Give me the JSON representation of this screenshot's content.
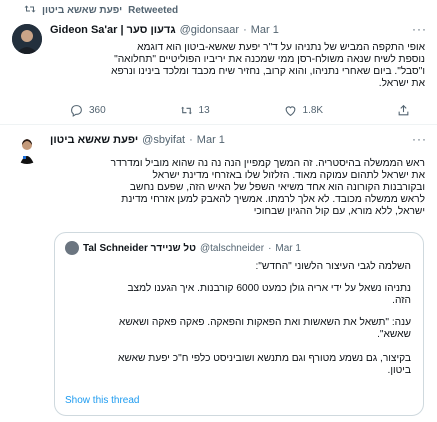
{
  "retweet_header": {
    "user": "יפעת שאשא ביטון",
    "label": "Retweeted"
  },
  "tweet1": {
    "display_name": "Gideon Sa'ar | גדעון סער",
    "handle": "@gidonsaar",
    "sep": "·",
    "date": "Mar 1",
    "lines": [
      "אופי התקפה המביש של נתניהו על ד\"ר יפעת שאשא-ביטון הוא דוגמא",
      "נוספת לשיח שנאה משולח-רסן ממי שמכנה את יריביו הפוליטיים \"תחלואה\"",
      "ו\"סבל\". ביום שאחרי נתניהו, והוא קרוב, נחזיר שיח מכבד ומלכד בינינו ונרפא",
      "את ישראל."
    ],
    "replies": "360",
    "retweets": "13",
    "likes": "1.8K"
  },
  "tweet2": {
    "display_name": "יפעת שאשא ביטון",
    "handle": "@sbyifat",
    "sep": "·",
    "date": "Mar 1",
    "lines": [
      "ראש הממשלה בהיסטריה. זה המשך קמפיין הנה נה נה שהוא מוביל ומדרדר",
      "את ישראל לתהום עמוקה מאוד. הזלזול שלו באזרחי מדינת ישראל",
      "ובקורבנות הקורונה הוא אחד משיאי השפל של האיש הזה, שפעם נחשב",
      "לראש ממשלה מכובד. לא אלך לרמתו. אמשיך להאבק למען אזרחי מדינת",
      "ישראל, ללא מורא, עם קול ההגיון שבחוכי"
    ],
    "quote": {
      "display_name": "Tal Schneider טל שניידר",
      "handle": "@talschneider",
      "sep": "·",
      "date": "Mar 1",
      "p1": "השלמה לגבי העיצור הלשוני \"החדש\":",
      "p2a": "נתניהו נשאל על ידי אריה גולן כמעט 6000 קורבנות. איך הגענו למצב",
      "p2b": "הזה.",
      "p3a": "ענה: \"תשאל את השאשות ואת הפאקות והפאקה. פאקה פאקה ושאשא",
      "p3b": "שאשא\".",
      "p4a": "בקיצור, גם נשמע מטורף וגם מתנשא ושוביניסט כלפי ח\"כ יפעת שאשא",
      "p4b": "ביטון.",
      "show_thread": "Show this thread"
    }
  },
  "colors": {
    "accent": "#1d9bf0",
    "muted": "#536471",
    "border": "#cfd9de"
  },
  "icons": [
    "retweet-icon",
    "reply-icon",
    "like-icon",
    "share-icon",
    "more-icon"
  ]
}
